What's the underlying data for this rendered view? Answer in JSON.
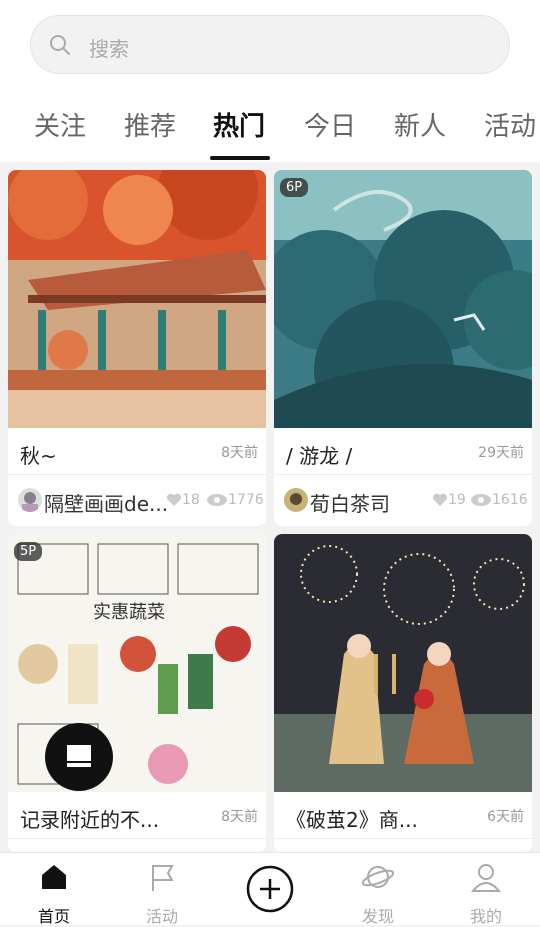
{
  "search": {
    "placeholder": "搜索"
  },
  "tabs": [
    {
      "label": "关注"
    },
    {
      "label": "推荐"
    },
    {
      "label": "热门"
    },
    {
      "label": "今日"
    },
    {
      "label": "新人"
    },
    {
      "label": "活动"
    }
  ],
  "active_tab": "热门",
  "cards": [
    {
      "title": "秋~",
      "age": "8天前",
      "author": "隔壁画画de...",
      "likes": "18",
      "views": "1776",
      "badge": ""
    },
    {
      "title": "/ 游龙 /",
      "age": "29天前",
      "author": "荀白茶司",
      "likes": "19",
      "views": "1616",
      "badge": "6P"
    },
    {
      "title": "记录附近的不...",
      "age": "8天前",
      "badge": "5P"
    },
    {
      "title": "《破茧2》商...",
      "age": "6天前",
      "badge": ""
    }
  ],
  "bottom_nav": [
    {
      "label": "首页"
    },
    {
      "label": "活动"
    },
    {
      "label": "发现"
    },
    {
      "label": "我的"
    }
  ],
  "colors": {
    "accent": "#111111",
    "inactive": "#aaaaaa",
    "background": "#f2f2f2"
  }
}
